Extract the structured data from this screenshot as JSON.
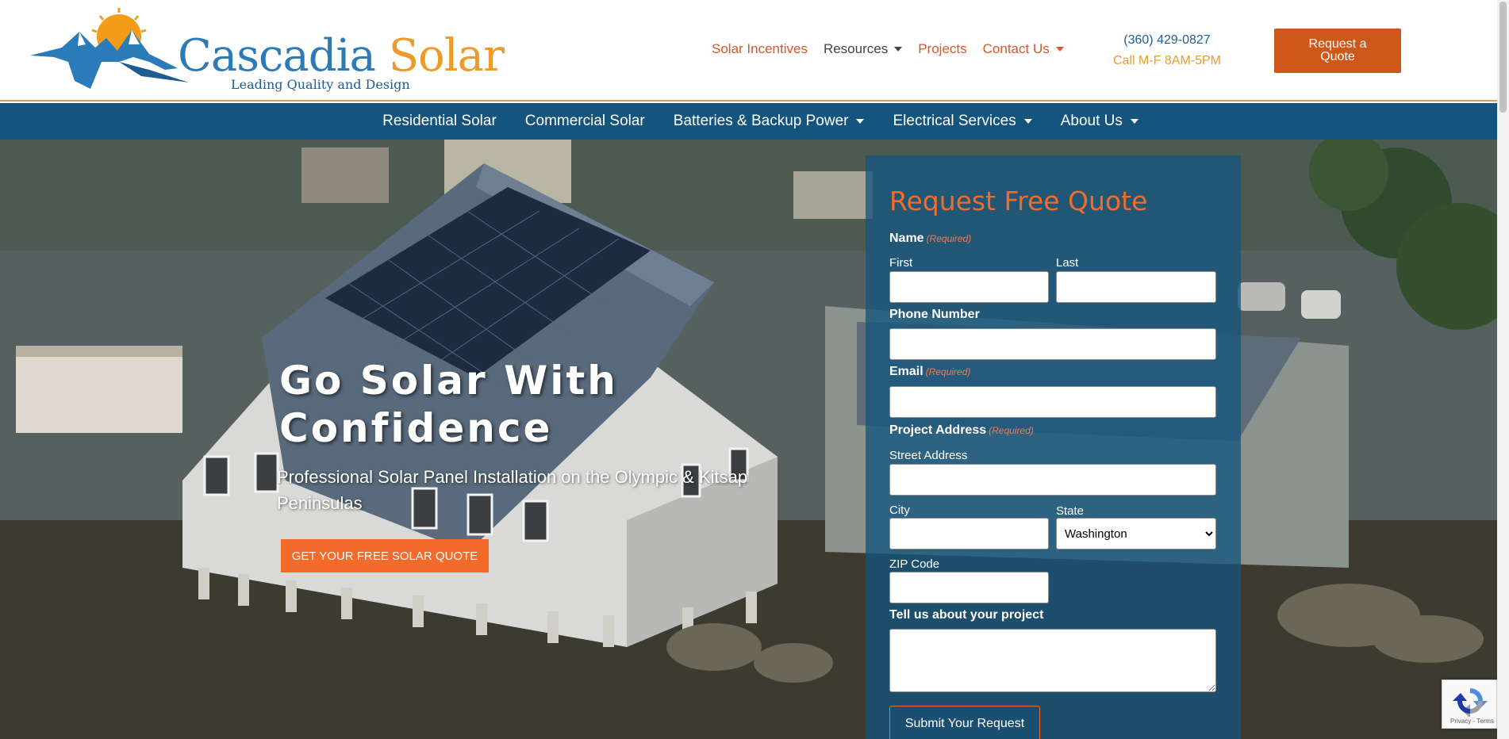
{
  "brand": {
    "name_part1": "Cascadia",
    "name_part2": "Solar",
    "tagline": "Leading Quality and Design",
    "colors": {
      "blue": "#2a7bb7",
      "orange": "#ee9a2a",
      "navy": "#15547d",
      "cta": "#d0571a"
    }
  },
  "top_nav": {
    "items": [
      {
        "label": "Solar Incentives",
        "dropdown": false
      },
      {
        "label": "Resources",
        "dropdown": true
      },
      {
        "label": "Projects",
        "dropdown": false
      },
      {
        "label": "Contact Us",
        "dropdown": true
      }
    ],
    "phone": "(360) 429-0827",
    "hours": "Call M-F 8AM-5PM",
    "quote_button": "Request a Quote"
  },
  "main_nav": {
    "items": [
      {
        "label": "Residential Solar",
        "dropdown": false
      },
      {
        "label": "Commercial Solar",
        "dropdown": false
      },
      {
        "label": "Batteries & Backup Power",
        "dropdown": true
      },
      {
        "label": "Electrical Services",
        "dropdown": true
      },
      {
        "label": "About Us",
        "dropdown": true
      }
    ]
  },
  "hero": {
    "title": "Go Solar With Confidence",
    "subtitle": "Professional Solar Panel Installation on the Olympic & Kitsap Peninsulas",
    "cta": "GET YOUR FREE SOLAR QUOTE"
  },
  "form": {
    "title": "Request Free Quote",
    "required_text": "(Required)",
    "name_label": "Name",
    "first_label": "First",
    "last_label": "Last",
    "phone_label": "Phone Number",
    "email_label": "Email",
    "address_label": "Project Address",
    "street_label": "Street Address",
    "city_label": "City",
    "state_label": "State",
    "state_value": "Washington",
    "zip_label": "ZIP Code",
    "project_label": "Tell us about your project",
    "submit": "Submit Your Request"
  },
  "recaptcha": {
    "text": "Privacy - Terms"
  }
}
